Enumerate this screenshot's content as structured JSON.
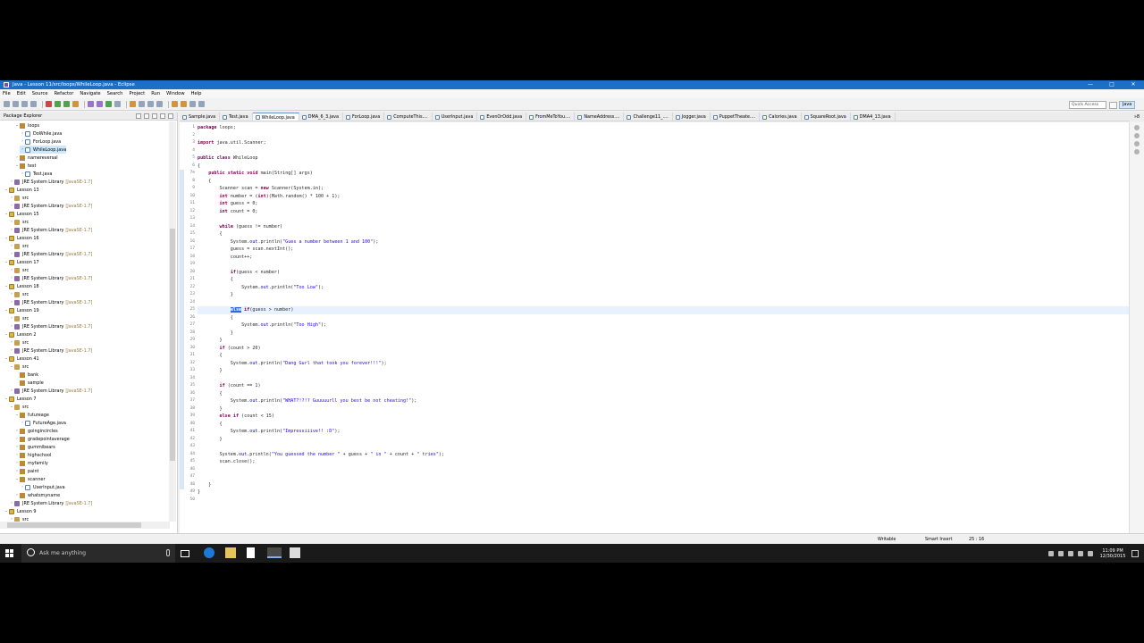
{
  "window": {
    "title": "Java - Lesson 11/src/loops/WhileLoop.java - Eclipse",
    "minimize": "—",
    "maximize": "□",
    "close": "✕"
  },
  "menu": [
    "File",
    "Edit",
    "Source",
    "Refactor",
    "Navigate",
    "Search",
    "Project",
    "Run",
    "Window",
    "Help"
  ],
  "toolbar": {
    "quick_access": "Quick Access",
    "perspective": "Java"
  },
  "explorer": {
    "title": "Package Explorer",
    "items": [
      {
        "label": "loops",
        "lvl": 3,
        "icon": "package-icon",
        "exp": "v"
      },
      {
        "label": "DoWhile.java",
        "lvl": 4,
        "icon": "java-file-icon",
        "exp": ">"
      },
      {
        "label": "ForLoop.java",
        "lvl": 4,
        "icon": "java-file-icon",
        "exp": ">"
      },
      {
        "label": "WhileLoop.java",
        "lvl": 4,
        "icon": "java-file-icon",
        "exp": ">",
        "sel": true
      },
      {
        "label": "namereversal",
        "lvl": 3,
        "icon": "package-icon",
        "exp": ">"
      },
      {
        "label": "test",
        "lvl": 3,
        "icon": "package-icon",
        "exp": "v"
      },
      {
        "label": "Test.java",
        "lvl": 4,
        "icon": "java-file-icon",
        "exp": ">"
      },
      {
        "label": "JRE System Library",
        "lib": "[JavaSE-1.7]",
        "lvl": 2,
        "icon": "library-icon",
        "exp": ">"
      },
      {
        "label": "Lesson 13",
        "lvl": 1,
        "icon": "project-icon",
        "exp": "v"
      },
      {
        "label": "src",
        "lvl": 2,
        "icon": "source-folder-icon",
        "exp": ">"
      },
      {
        "label": "JRE System Library",
        "lib": "[JavaSE-1.7]",
        "lvl": 2,
        "icon": "library-icon",
        "exp": ">"
      },
      {
        "label": "Lesson 15",
        "lvl": 1,
        "icon": "project-icon",
        "exp": "v"
      },
      {
        "label": "src",
        "lvl": 2,
        "icon": "source-folder-icon",
        "exp": ">"
      },
      {
        "label": "JRE System Library",
        "lib": "[JavaSE-1.7]",
        "lvl": 2,
        "icon": "library-icon",
        "exp": ">"
      },
      {
        "label": "Lesson 16",
        "lvl": 1,
        "icon": "project-icon",
        "exp": "v"
      },
      {
        "label": "src",
        "lvl": 2,
        "icon": "source-folder-icon",
        "exp": ">"
      },
      {
        "label": "JRE System Library",
        "lib": "[JavaSE-1.7]",
        "lvl": 2,
        "icon": "library-icon",
        "exp": ">"
      },
      {
        "label": "Lesson 17",
        "lvl": 1,
        "icon": "project-icon",
        "exp": "v"
      },
      {
        "label": "src",
        "lvl": 2,
        "icon": "source-folder-icon",
        "exp": ">"
      },
      {
        "label": "JRE System Library",
        "lib": "[JavaSE-1.7]",
        "lvl": 2,
        "icon": "library-icon",
        "exp": ">"
      },
      {
        "label": "Lesson 18",
        "lvl": 1,
        "icon": "project-icon",
        "exp": "v"
      },
      {
        "label": "src",
        "lvl": 2,
        "icon": "source-folder-icon",
        "exp": ">"
      },
      {
        "label": "JRE System Library",
        "lib": "[JavaSE-1.7]",
        "lvl": 2,
        "icon": "library-icon",
        "exp": ">"
      },
      {
        "label": "Lesson 19",
        "lvl": 1,
        "icon": "project-icon",
        "exp": "v"
      },
      {
        "label": "src",
        "lvl": 2,
        "icon": "source-folder-icon",
        "exp": ">"
      },
      {
        "label": "JRE System Library",
        "lib": "[JavaSE-1.7]",
        "lvl": 2,
        "icon": "library-icon",
        "exp": ">"
      },
      {
        "label": "Lesson 2",
        "lvl": 1,
        "icon": "project-icon",
        "exp": "v"
      },
      {
        "label": "src",
        "lvl": 2,
        "icon": "source-folder-icon",
        "exp": ">"
      },
      {
        "label": "JRE System Library",
        "lib": "[JavaSE-1.7]",
        "lvl": 2,
        "icon": "library-icon",
        "exp": ">"
      },
      {
        "label": "Lesson 41",
        "lvl": 1,
        "icon": "project-icon",
        "exp": "v"
      },
      {
        "label": "src",
        "lvl": 2,
        "icon": "source-folder-icon",
        "exp": "v"
      },
      {
        "label": "bank",
        "lvl": 3,
        "icon": "package-icon",
        "exp": ""
      },
      {
        "label": "sample",
        "lvl": 3,
        "icon": "package-icon",
        "exp": ""
      },
      {
        "label": "JRE System Library",
        "lib": "[JavaSE-1.7]",
        "lvl": 2,
        "icon": "library-icon",
        "exp": ">"
      },
      {
        "label": "Lesson 7",
        "lvl": 1,
        "icon": "project-icon",
        "exp": "v"
      },
      {
        "label": "src",
        "lvl": 2,
        "icon": "source-folder-icon",
        "exp": "v"
      },
      {
        "label": "futureage",
        "lvl": 3,
        "icon": "package-icon",
        "exp": "v"
      },
      {
        "label": "FutureAge.java",
        "lvl": 4,
        "icon": "java-file-icon",
        "exp": ">"
      },
      {
        "label": "goingincircles",
        "lvl": 3,
        "icon": "package-icon",
        "exp": ">"
      },
      {
        "label": "gradepointaverage",
        "lvl": 3,
        "icon": "package-icon",
        "exp": ">"
      },
      {
        "label": "gummibears",
        "lvl": 3,
        "icon": "package-icon",
        "exp": ">"
      },
      {
        "label": "highschool",
        "lvl": 3,
        "icon": "package-icon",
        "exp": ">"
      },
      {
        "label": "myfamily",
        "lvl": 3,
        "icon": "package-icon",
        "exp": ">"
      },
      {
        "label": "paint",
        "lvl": 3,
        "icon": "package-icon",
        "exp": ">"
      },
      {
        "label": "scanner",
        "lvl": 3,
        "icon": "package-icon",
        "exp": "v"
      },
      {
        "label": "UserInput.java",
        "lvl": 4,
        "icon": "java-file-icon",
        "exp": ">"
      },
      {
        "label": "whatsmyname",
        "lvl": 3,
        "icon": "package-icon",
        "exp": ">"
      },
      {
        "label": "JRE System Library",
        "lib": "[JavaSE-1.7]",
        "lvl": 2,
        "icon": "library-icon",
        "exp": ">"
      },
      {
        "label": "Lesson 9",
        "lvl": 1,
        "icon": "project-icon",
        "exp": "v"
      },
      {
        "label": "src",
        "lvl": 2,
        "icon": "source-folder-icon",
        "exp": ">"
      }
    ]
  },
  "tabs": [
    {
      "label": "Sample.java"
    },
    {
      "label": "Test.java"
    },
    {
      "label": "WhileLoop.java",
      "active": true
    },
    {
      "label": "DMA_6_3.java"
    },
    {
      "label": "ForLoop.java"
    },
    {
      "label": "ComputeThis...."
    },
    {
      "label": "UserInput.java"
    },
    {
      "label": "EvenOrOdd.java"
    },
    {
      "label": "FromMeToYou...."
    },
    {
      "label": "NameAddress...."
    },
    {
      "label": "Challenge11_...."
    },
    {
      "label": "Jogger.java"
    },
    {
      "label": "PuppetTheate...."
    },
    {
      "label": "Calories.java"
    },
    {
      "label": "SquareRoot.java"
    },
    {
      "label": "DMA4_13.java"
    }
  ],
  "tab_overflow": "»8",
  "code": [
    {
      "n": "1",
      "t": [
        [
          "kw",
          "package"
        ],
        [
          "p",
          " loops;"
        ]
      ]
    },
    {
      "n": "2",
      "t": []
    },
    {
      "n": "3",
      "t": [
        [
          "kw",
          "import"
        ],
        [
          "p",
          " java.util.Scanner;"
        ]
      ]
    },
    {
      "n": "4",
      "t": []
    },
    {
      "n": "5",
      "t": [
        [
          "kw",
          "public"
        ],
        [
          "p",
          " "
        ],
        [
          "kw",
          "class"
        ],
        [
          "p",
          " WhileLoop"
        ]
      ]
    },
    {
      "n": "6",
      "t": [
        [
          "p",
          "{"
        ]
      ]
    },
    {
      "n": "7⊖",
      "t": [
        [
          "p",
          "    "
        ],
        [
          "kw",
          "public"
        ],
        [
          "p",
          " "
        ],
        [
          "kw",
          "static"
        ],
        [
          "p",
          " "
        ],
        [
          "kw",
          "void"
        ],
        [
          "p",
          " main(String[] args)"
        ]
      ]
    },
    {
      "n": "8",
      "t": [
        [
          "p",
          "    {"
        ]
      ]
    },
    {
      "n": "9",
      "t": [
        [
          "p",
          "        Scanner scan = "
        ],
        [
          "kw",
          "new"
        ],
        [
          "p",
          " Scanner(System."
        ],
        [
          "fl",
          "in"
        ],
        [
          "p",
          ");"
        ]
      ]
    },
    {
      "n": "10",
      "t": [
        [
          "p",
          "        "
        ],
        [
          "kw",
          "int"
        ],
        [
          "p",
          " number = ("
        ],
        [
          "kw",
          "int"
        ],
        [
          "p",
          ")(Math."
        ],
        [
          "p",
          "random"
        ],
        [
          "p",
          "() * 100 + 1);"
        ]
      ]
    },
    {
      "n": "11",
      "t": [
        [
          "p",
          "        "
        ],
        [
          "kw",
          "int"
        ],
        [
          "p",
          " guess = 0;"
        ]
      ]
    },
    {
      "n": "12",
      "t": [
        [
          "p",
          "        "
        ],
        [
          "kw",
          "int"
        ],
        [
          "p",
          " count = 0;"
        ]
      ]
    },
    {
      "n": "13",
      "t": []
    },
    {
      "n": "14",
      "t": [
        [
          "p",
          "        "
        ],
        [
          "kw",
          "while"
        ],
        [
          "p",
          " (guess != number)"
        ]
      ]
    },
    {
      "n": "15",
      "t": [
        [
          "p",
          "        {"
        ]
      ]
    },
    {
      "n": "16",
      "t": [
        [
          "p",
          "            System."
        ],
        [
          "fl",
          "out"
        ],
        [
          "p",
          ".println("
        ],
        [
          "st",
          "\"Gues a number between 1 and 100\""
        ],
        [
          "p",
          ");"
        ]
      ]
    },
    {
      "n": "17",
      "t": [
        [
          "p",
          "            guess = scan.nextInt();"
        ]
      ]
    },
    {
      "n": "18",
      "t": [
        [
          "p",
          "            count++;"
        ]
      ]
    },
    {
      "n": "19",
      "t": []
    },
    {
      "n": "20",
      "t": [
        [
          "p",
          "            "
        ],
        [
          "kw",
          "if"
        ],
        [
          "p",
          "(guess < number)"
        ]
      ]
    },
    {
      "n": "21",
      "t": [
        [
          "p",
          "            {"
        ]
      ]
    },
    {
      "n": "22",
      "t": [
        [
          "p",
          "                System."
        ],
        [
          "fl",
          "out"
        ],
        [
          "p",
          ".println("
        ],
        [
          "st",
          "\"Too Low\""
        ],
        [
          "p",
          ");"
        ]
      ]
    },
    {
      "n": "23",
      "t": [
        [
          "p",
          "            }"
        ]
      ]
    },
    {
      "n": "24",
      "t": []
    },
    {
      "n": "25",
      "cur": true,
      "t": [
        [
          "p",
          "            "
        ],
        [
          "hl",
          "else"
        ],
        [
          "p",
          " "
        ],
        [
          "kw",
          "if"
        ],
        [
          "p",
          "(guess > number)"
        ]
      ]
    },
    {
      "n": "26",
      "t": [
        [
          "p",
          "            {"
        ]
      ]
    },
    {
      "n": "27",
      "t": [
        [
          "p",
          "                System."
        ],
        [
          "fl",
          "out"
        ],
        [
          "p",
          ".println("
        ],
        [
          "st",
          "\"Too High\""
        ],
        [
          "p",
          ");"
        ]
      ]
    },
    {
      "n": "28",
      "t": [
        [
          "p",
          "            }"
        ]
      ]
    },
    {
      "n": "29",
      "t": [
        [
          "p",
          "        }"
        ]
      ]
    },
    {
      "n": "30",
      "t": [
        [
          "p",
          "        "
        ],
        [
          "kw",
          "if"
        ],
        [
          "p",
          " (count > 20)"
        ]
      ]
    },
    {
      "n": "31",
      "t": [
        [
          "p",
          "        {"
        ]
      ]
    },
    {
      "n": "32",
      "t": [
        [
          "p",
          "            System."
        ],
        [
          "fl",
          "out"
        ],
        [
          "p",
          ".println("
        ],
        [
          "st",
          "\"Dang Gurl that took you forever!!!\""
        ],
        [
          "p",
          ");"
        ]
      ]
    },
    {
      "n": "33",
      "t": [
        [
          "p",
          "        }"
        ]
      ]
    },
    {
      "n": "34",
      "t": []
    },
    {
      "n": "35",
      "t": [
        [
          "p",
          "        "
        ],
        [
          "kw",
          "if"
        ],
        [
          "p",
          " (count == 1)"
        ]
      ]
    },
    {
      "n": "36",
      "t": [
        [
          "p",
          "        {"
        ]
      ]
    },
    {
      "n": "37",
      "t": [
        [
          "p",
          "            System."
        ],
        [
          "fl",
          "out"
        ],
        [
          "p",
          ".println("
        ],
        [
          "st",
          "\"WHAT?!?!? Guuuuurll you best be not cheating!\""
        ],
        [
          "p",
          ");"
        ]
      ]
    },
    {
      "n": "38",
      "t": [
        [
          "p",
          "        }"
        ]
      ]
    },
    {
      "n": "39",
      "t": [
        [
          "p",
          "        "
        ],
        [
          "kw",
          "else"
        ],
        [
          "p",
          " "
        ],
        [
          "kw",
          "if"
        ],
        [
          "p",
          " (count < 15)"
        ]
      ]
    },
    {
      "n": "40",
      "t": [
        [
          "p",
          "        {"
        ]
      ]
    },
    {
      "n": "41",
      "t": [
        [
          "p",
          "            System."
        ],
        [
          "fl",
          "out"
        ],
        [
          "p",
          ".println("
        ],
        [
          "st",
          "\"Impressiiive!! :D\""
        ],
        [
          "p",
          ");"
        ]
      ]
    },
    {
      "n": "42",
      "t": [
        [
          "p",
          "        }"
        ]
      ]
    },
    {
      "n": "43",
      "t": []
    },
    {
      "n": "44",
      "t": [
        [
          "p",
          "        System."
        ],
        [
          "fl",
          "out"
        ],
        [
          "p",
          ".println("
        ],
        [
          "st",
          "\"You guessed the number \""
        ],
        [
          "p",
          " + guess + "
        ],
        [
          "st",
          "\" in \""
        ],
        [
          "p",
          " + count + "
        ],
        [
          "st",
          "\" tries\""
        ],
        [
          "p",
          ");"
        ]
      ]
    },
    {
      "n": "45",
      "t": [
        [
          "p",
          "        scan.close();"
        ]
      ]
    },
    {
      "n": "46",
      "t": []
    },
    {
      "n": "47",
      "t": []
    },
    {
      "n": "48",
      "t": [
        [
          "p",
          "    }"
        ]
      ]
    },
    {
      "n": "49",
      "t": [
        [
          "p",
          "}"
        ]
      ]
    },
    {
      "n": "50",
      "t": []
    }
  ],
  "status": {
    "writable": "Writable",
    "insert": "Smart Insert",
    "position": "25 : 16"
  },
  "taskbar": {
    "search_placeholder": "Ask me anything",
    "time": "11:09 PM",
    "date": "12/30/2015"
  }
}
